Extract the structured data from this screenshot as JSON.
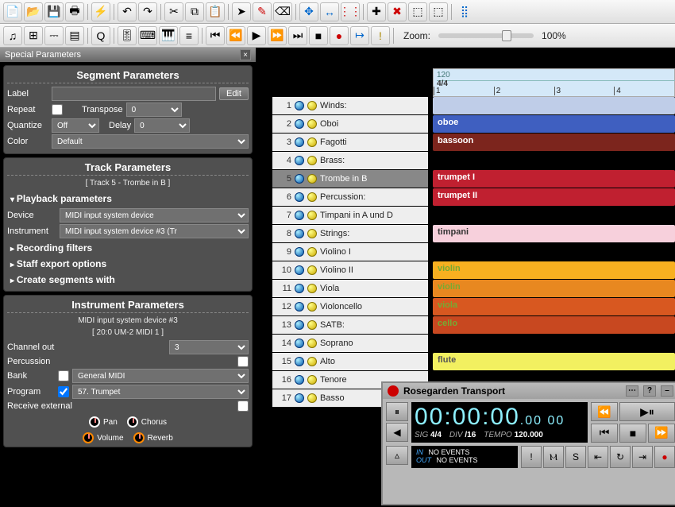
{
  "panel_title": "Special Parameters",
  "zoom": {
    "label": "Zoom:",
    "value": "100%"
  },
  "segment_params": {
    "header": "Segment Parameters",
    "label_lbl": "Label",
    "label_val": "",
    "edit_btn": "Edit",
    "repeat_lbl": "Repeat",
    "transpose_lbl": "Transpose",
    "transpose_val": "0",
    "quantize_lbl": "Quantize",
    "quantize_val": "Off",
    "delay_lbl": "Delay",
    "delay_val": "0",
    "color_lbl": "Color",
    "color_val": "Default"
  },
  "track_params": {
    "header": "Track Parameters",
    "sub": "[ Track 5 - Trombe in B ]",
    "playback_header": "Playback parameters",
    "device_lbl": "Device",
    "device_val": "MIDI input system device",
    "instrument_lbl": "Instrument",
    "instrument_val": "MIDI input system device #3 (Tr",
    "recording": "Recording filters",
    "staff": "Staff export options",
    "create": "Create segments with"
  },
  "instrument_params": {
    "header": "Instrument Parameters",
    "sub1": "MIDI input system device  #3",
    "sub2": "[ 20:0 UM-2 MIDI 1 ]",
    "channel_lbl": "Channel out",
    "channel_val": "3",
    "percussion_lbl": "Percussion",
    "bank_lbl": "Bank",
    "bank_val": "General MIDI",
    "program_lbl": "Program",
    "program_val": "57. Trumpet",
    "receive_lbl": "Receive external",
    "knobs": {
      "pan": "Pan",
      "chorus": "Chorus",
      "volume": "Volume",
      "reverb": "Reverb"
    }
  },
  "tracks": [
    {
      "n": "1",
      "name": "Winds:"
    },
    {
      "n": "2",
      "name": "Oboi"
    },
    {
      "n": "3",
      "name": "Fagotti"
    },
    {
      "n": "4",
      "name": "Brass:"
    },
    {
      "n": "5",
      "name": "Trombe in B",
      "selected": true
    },
    {
      "n": "6",
      "name": "Percussion:"
    },
    {
      "n": "7",
      "name": "Timpani in A und D"
    },
    {
      "n": "8",
      "name": "Strings:"
    },
    {
      "n": "9",
      "name": "Violino I"
    },
    {
      "n": "10",
      "name": "Violino II"
    },
    {
      "n": "11",
      "name": "Viola"
    },
    {
      "n": "12",
      "name": "Violoncello"
    },
    {
      "n": "13",
      "name": "SATB:"
    },
    {
      "n": "14",
      "name": "Soprano"
    },
    {
      "n": "15",
      "name": "Alto"
    },
    {
      "n": "16",
      "name": "Tenore"
    },
    {
      "n": "17",
      "name": "Basso"
    }
  ],
  "ruler": {
    "tempo": "120",
    "sig": "4/4",
    "ticks": [
      "1",
      "2",
      "3",
      "4"
    ]
  },
  "segments": [
    {
      "color": "#bfcde8",
      "text": ""
    },
    {
      "color": "#3f5fc0",
      "text": "oboe",
      "tc": "#fff"
    },
    {
      "color": "#7c251d",
      "text": "bassoon",
      "tc": "#fff"
    },
    {
      "color": "",
      "text": ""
    },
    {
      "color": "#c02030",
      "text": "trumpet I",
      "tc": "#fff"
    },
    {
      "color": "#c02030",
      "text": "trumpet II",
      "tc": "#fff"
    },
    {
      "color": "",
      "text": ""
    },
    {
      "color": "#f7d0dc",
      "text": "timpani",
      "tc": "#333"
    },
    {
      "color": "",
      "text": ""
    },
    {
      "color": "#f8b020",
      "text": "violin",
      "tc": "#7a3"
    },
    {
      "color": "#e88820",
      "text": "violin",
      "tc": "#7a3"
    },
    {
      "color": "#d85820",
      "text": "viola",
      "tc": "#7a3"
    },
    {
      "color": "#c84820",
      "text": "cello",
      "tc": "#7a3"
    },
    {
      "color": "",
      "text": ""
    },
    {
      "color": "#f2f060",
      "text": "flute",
      "tc": "#555"
    }
  ],
  "transport": {
    "title": "Rosegarden Transport",
    "time_main": "00:00:00",
    "time_sub": "00 00",
    "sig_lbl": "SIG",
    "sig": "4/4",
    "div_lbl": "DIV",
    "div": "/16",
    "tempo_lbl": "TEMPO",
    "tempo": "120.000",
    "in_lbl": "IN",
    "in_val": "NO EVENTS",
    "out_lbl": "OUT",
    "out_val": "NO EVENTS"
  }
}
